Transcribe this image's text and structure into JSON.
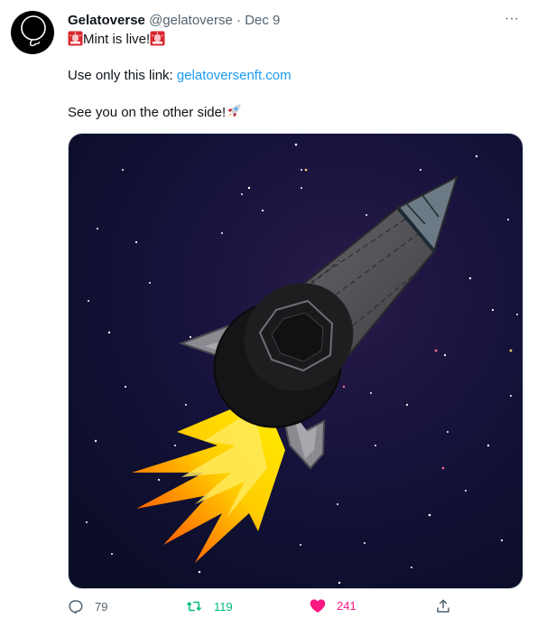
{
  "tweet": {
    "author_name": "Gelatoverse",
    "handle": "@gelatoverse",
    "separator": "·",
    "date": "Dec 9",
    "more_label": "···",
    "lines": {
      "mint": "Mint is live!",
      "link_prefix": "Use only this link: ",
      "link_text": "gelatoversenft.com",
      "farewell": "See you on the other side!"
    },
    "icons": {
      "siren": "police-light-emoji",
      "rocket": "rocket-emoji",
      "reply": "reply-icon",
      "retweet": "retweet-icon",
      "like": "heart-icon",
      "share": "share-icon"
    },
    "stats": {
      "replies": "79",
      "retweets": "119",
      "likes": "241"
    },
    "colors": {
      "link": "#1d9bf0",
      "retweet_active": "#00ba7c",
      "like_active": "#f91880",
      "muted": "#536471"
    }
  }
}
